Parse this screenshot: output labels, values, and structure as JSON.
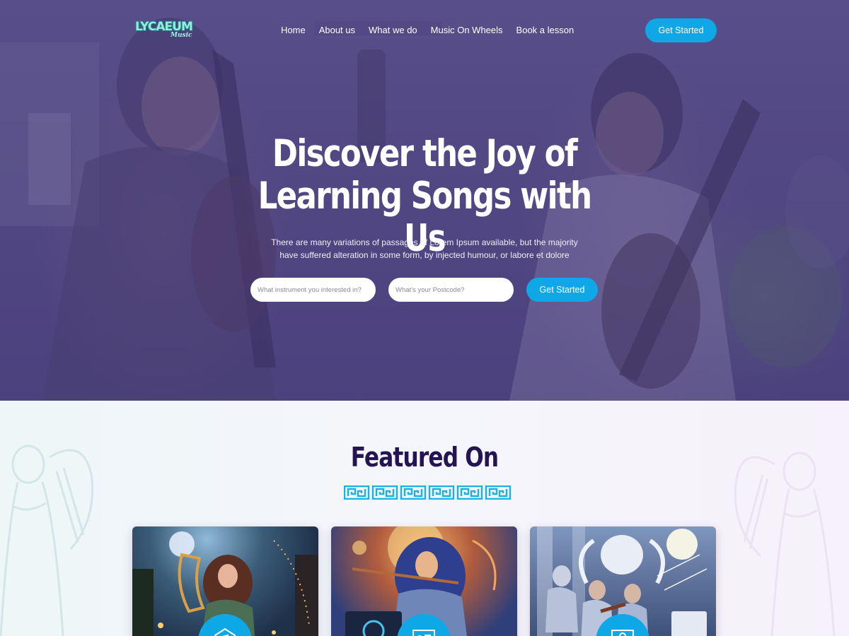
{
  "brand": {
    "logo_text": "LYCAEUM",
    "logo_subtext": "Music"
  },
  "nav": {
    "links": [
      "Home",
      "About us",
      "What we do",
      "Music On Wheels",
      "Book a lesson"
    ],
    "cta_label": "Get Started"
  },
  "hero": {
    "title_line1": "Discover the Joy of",
    "title_line2": "Learning Songs with Us",
    "subtitle_line1": "There are many variations of passages of Lorem Ipsum available, but the majority",
    "subtitle_line2": "have suffered alteration in some form, by injected humour, or labore et dolore",
    "instrument_placeholder": "What instrument you interested in?",
    "postcode_placeholder": "What’s your Postcode?",
    "cta_label": "Get Started"
  },
  "featured": {
    "title": "Featured On",
    "cards": [
      {
        "image": "harp-player-night-forest-image",
        "badge_icon": "house-music-icon"
      },
      {
        "image": "guitar-player-laptop-image",
        "badge_icon": "score-sheet-icon"
      },
      {
        "image": "string-ensemble-angel-image",
        "badge_icon": "lightbulb-board-icon"
      }
    ]
  },
  "colors": {
    "accent": "#10a7e6",
    "hero_overlay": "#483e80",
    "heading": "#241552",
    "greek_key": "#1bb2e0"
  }
}
